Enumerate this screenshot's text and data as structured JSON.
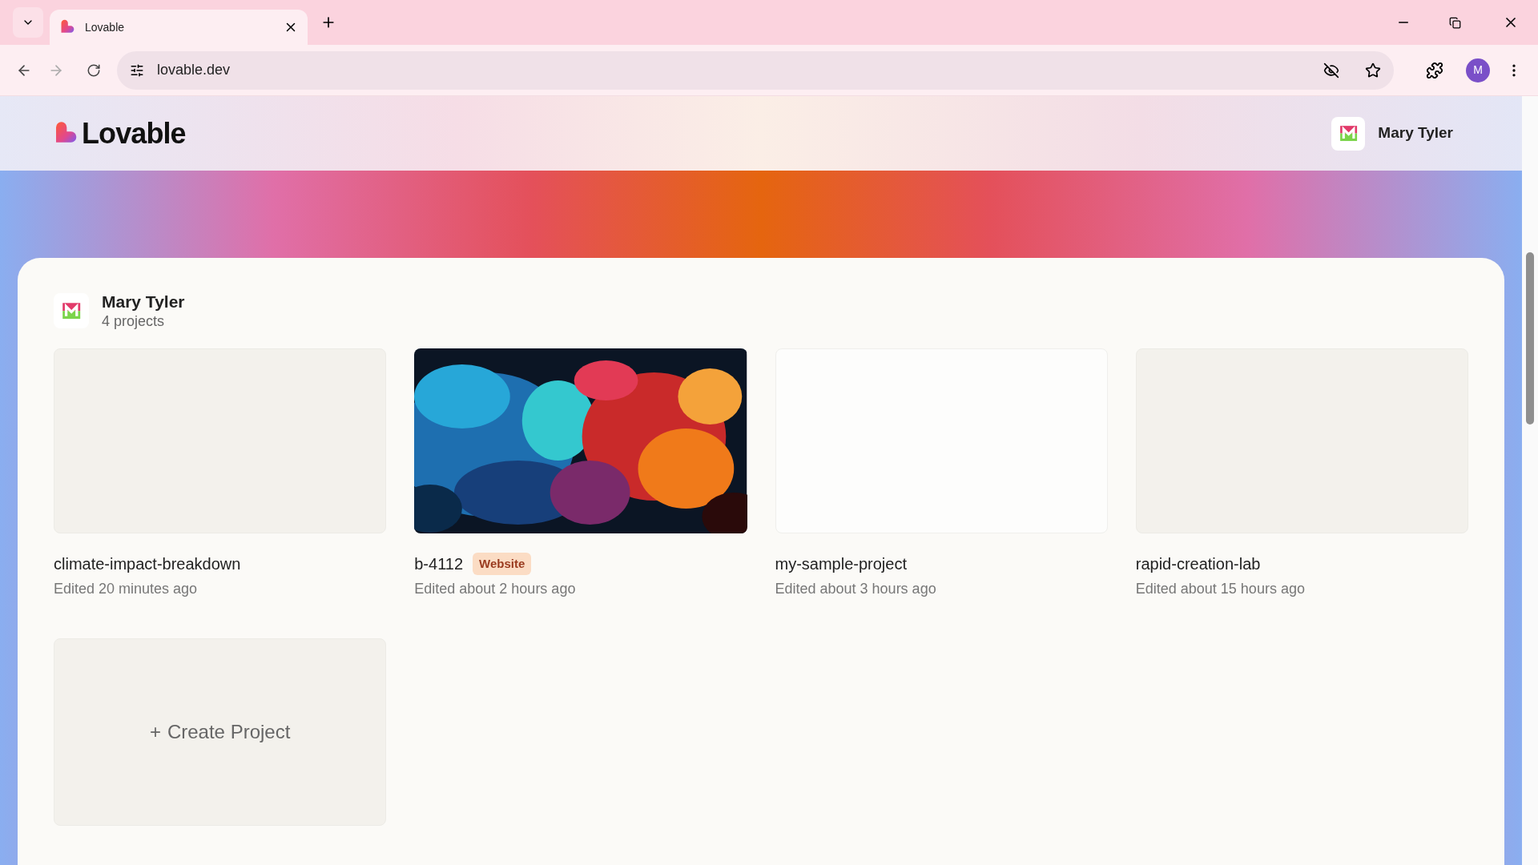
{
  "browser": {
    "tabs": [
      {
        "title": "Lovable",
        "selected": true
      }
    ],
    "address": "lovable.dev",
    "profile_initial": "M"
  },
  "header": {
    "logo": "Lovable",
    "user": "Mary Tyler"
  },
  "workspace": {
    "name": "Mary Tyler",
    "count": "4 projects"
  },
  "projects": [
    {
      "name": "climate-impact-breakdown",
      "edited": "Edited 20 minutes ago",
      "kind": "plain"
    },
    {
      "name": "b-4112",
      "badge": "Website",
      "edited": "Edited about 2 hours ago",
      "kind": "picture"
    },
    {
      "name": "my-sample-project",
      "edited": "Edited about 3 hours ago",
      "kind": "blank"
    },
    {
      "name": "rapid-creation-lab",
      "edited": "Edited about 15 hours ago",
      "kind": "plain"
    }
  ],
  "create": {
    "icon": "+",
    "label": "Create Project"
  }
}
